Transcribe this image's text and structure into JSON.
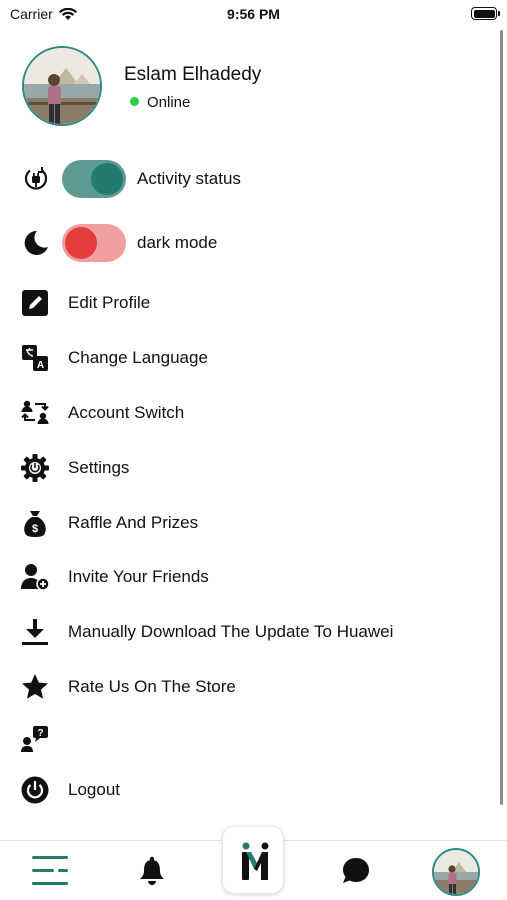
{
  "status_bar": {
    "carrier": "Carrier",
    "time": "9:56 PM"
  },
  "profile": {
    "name": "Eslam Elhadedy",
    "status": "Online"
  },
  "toggles": [
    {
      "label": "Activity status",
      "icon": "power-plug-icon",
      "state": "on"
    },
    {
      "label": "dark mode",
      "icon": "moon-icon",
      "state": "off"
    }
  ],
  "menu": [
    {
      "label": "Edit Profile",
      "icon": "edit-icon"
    },
    {
      "label": "Change Language",
      "icon": "translate-icon"
    },
    {
      "label": "Account Switch",
      "icon": "account-switch-icon"
    },
    {
      "label": "Settings",
      "icon": "gear-icon"
    },
    {
      "label": "Raffle And Prizes",
      "icon": "money-bag-icon"
    },
    {
      "label": "Invite Your Friends",
      "icon": "add-user-icon"
    },
    {
      "label": "Manually Download The Update To Huawei",
      "icon": "download-icon"
    },
    {
      "label": "Rate Us On The Store",
      "icon": "star-icon"
    },
    {
      "label": "",
      "icon": "support-question-icon"
    },
    {
      "label": "Logout",
      "icon": "power-icon"
    }
  ],
  "tab_bar": {
    "tabs": [
      "menu-icon",
      "bell-icon",
      "home-logo-icon",
      "chat-icon",
      "profile-avatar"
    ]
  },
  "colors": {
    "accent": "#237a6e",
    "toggle_on_track": "#5c9a93",
    "toggle_off_knob": "#e33c3c",
    "toggle_off_track": "#f0a0a0",
    "online": "#27d23a"
  }
}
